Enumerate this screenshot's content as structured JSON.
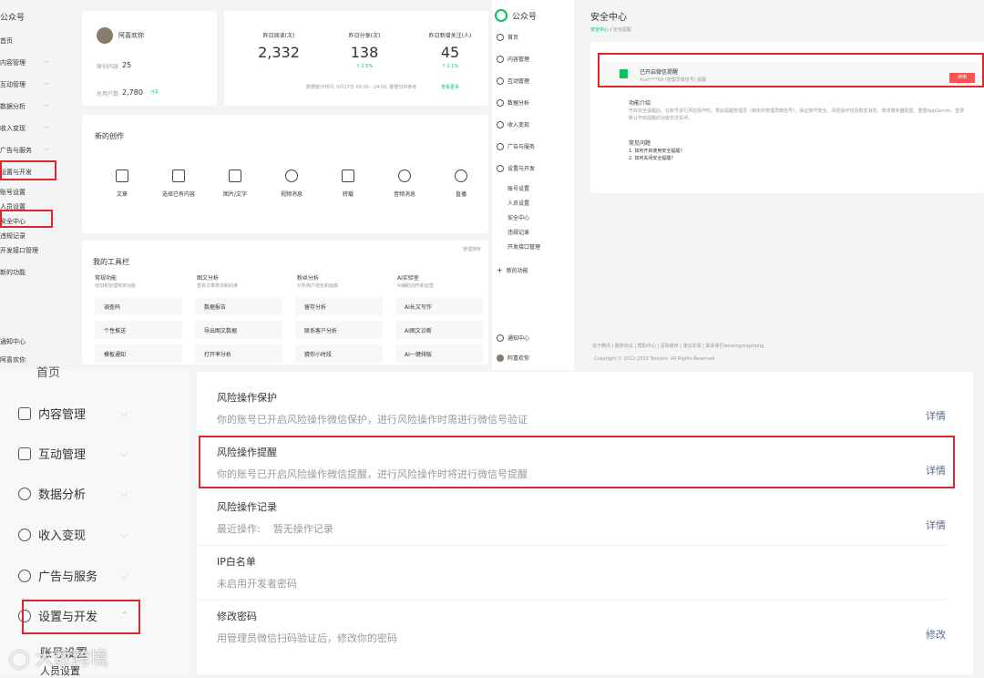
{
  "left_panel": {
    "app_title": "公众号",
    "nav": [
      "首页",
      "内容管理",
      "互动管理",
      "数据分析",
      "收入变现",
      "广告与服务",
      "设置与开发",
      "账号设置",
      "人员设置",
      "安全中心",
      "违规记录",
      "开发接口管理",
      "新的功能",
      "通知中心",
      "阿喜欢你"
    ],
    "user": {
      "name": "阿喜欢你",
      "stats": [
        {
          "label": "原创内容",
          "value": "25"
        },
        {
          "label": "总用户数",
          "value": "2,780",
          "badge": "+1"
        }
      ]
    },
    "overview": {
      "items": [
        {
          "label": "昨日阅读(次)",
          "value": "2,332"
        },
        {
          "label": "昨日分享(次)",
          "value": "138",
          "delta": "↑ 2.5%"
        },
        {
          "label": "昨日新增关注(人)",
          "value": "45",
          "delta": "↑ 2.1%"
        }
      ],
      "note": "数据统计时间: 9月17日 00:00 - 24:00, 数据仅供参考",
      "link": "查看更多"
    },
    "new_creation": {
      "title": "新的创作",
      "items": [
        "文章",
        "选择已有内容",
        "图片/文字",
        "视频消息",
        "转载",
        "音频消息",
        "直播"
      ]
    },
    "tools": {
      "title": "我的工具栏",
      "manage": "管理排序",
      "cats": [
        {
          "name": "常规功能",
          "desc": "增加和管理常用功能"
        },
        {
          "name": "图文分析",
          "desc": "查看文章表现和阅读"
        },
        {
          "name": "粉丝分析",
          "desc": "分析用户增长和画像"
        },
        {
          "name": "AI实验室",
          "desc": "AI辅助创作和运营"
        }
      ],
      "items": [
        "调查码",
        "数据报告",
        "留存分析",
        "AI长文写作",
        "个性推送",
        "导出图文数据",
        "联系客户分析",
        "AI图文诊断",
        "模板通知",
        "打开率分析",
        "猜你小时段",
        "AI一键排版"
      ]
    }
  },
  "right_panel": {
    "app_title": "公众号",
    "nav": [
      "首页",
      "内容管理",
      "互动管理",
      "数据分析",
      "收入变现",
      "广告与服务",
      "设置与开发",
      "账号设置",
      "人员设置",
      "安全中心",
      "违规记录",
      "开发接口管理",
      "新的功能",
      "通知中心",
      "阿喜欢你"
    ],
    "page_title": "安全中心",
    "breadcrumb": [
      "安全中心",
      "安全提醒"
    ],
    "status_title": "已开启微信提醒",
    "status_desc": "Xue****69 (管理员微信号) 提醒",
    "disable_btn": "停用",
    "func_title": "功能介绍",
    "func_desc": "开启安全提醒后，在账号进行风险操作时，将会提醒管理员（绑定的管理员微信号），保证账号安全。风险操作包括群发消息、修改服务器配置、重置AppSecret，登录新认开启提醒的功能无法关闭。",
    "faq_title": "常见问题",
    "faq": [
      "1. 如何开启使用安全提醒?",
      "2. 如何关闭安全提醒?"
    ],
    "footer_links": [
      "关于腾讯",
      "服务协议",
      "帮助中心",
      "清除缓存",
      "建议反馈",
      "联系我们weixingongzhong"
    ],
    "copyright": "Copyright © 2012-2025 Tencent. All Rights Reserved."
  },
  "bottom_panel": {
    "nav": [
      "首页",
      "内容管理",
      "互动管理",
      "数据分析",
      "收入变现",
      "广告与服务",
      "设置与开发",
      "账号设置",
      "人员设置"
    ],
    "watermark": "大数跨境",
    "rows": [
      {
        "title": "风险操作保护",
        "desc": "你的账号已开启风险操作微信保护，进行风险操作时需进行微信号验证",
        "action": "详情"
      },
      {
        "title": "风险操作提醒",
        "desc": "你的账号已开启风险操作微信提醒，进行风险操作时将进行微信号提醒",
        "action": "详情"
      },
      {
        "title": "风险操作记录",
        "desc": "最近操作:    暂无操作记录",
        "action": "详情"
      },
      {
        "title": "IP白名单",
        "desc": "未启用开发者密码",
        "action": ""
      },
      {
        "title": "修改密码",
        "desc": "用管理员微信扫码验证后，修改你的密码",
        "action": "修改"
      }
    ]
  },
  "colors": {
    "accent": "#07c160",
    "highlight": "#e0252c",
    "link": "#576b95",
    "danger": "#fa5151"
  }
}
